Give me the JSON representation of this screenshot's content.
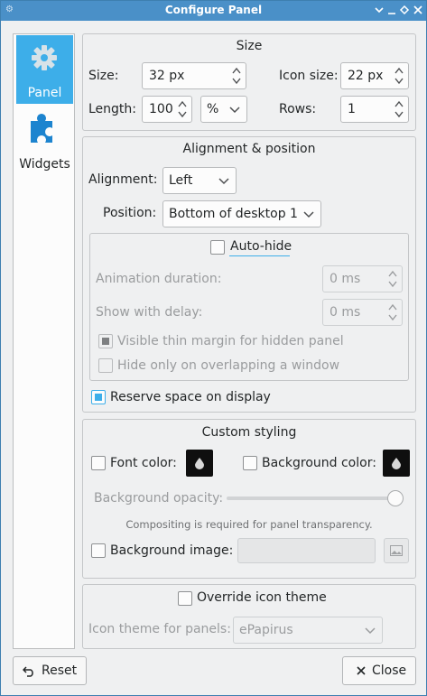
{
  "window": {
    "title": "Configure Panel"
  },
  "sidebar": {
    "items": [
      {
        "label": "Panel",
        "icon": "gear-icon",
        "active": true
      },
      {
        "label": "Widgets",
        "icon": "puzzle-icon",
        "active": false
      }
    ]
  },
  "size_group": {
    "title": "Size",
    "size_label": "Size:",
    "size_value": "32 px",
    "icon_size_label": "Icon size:",
    "icon_size_value": "22 px",
    "length_label": "Length:",
    "length_value": "100",
    "length_unit": "%",
    "rows_label": "Rows:",
    "rows_value": "1"
  },
  "alignment_group": {
    "title": "Alignment & position",
    "alignment_label": "Alignment:",
    "alignment_value": "Left",
    "position_label": "Position:",
    "position_value": "Bottom of desktop 1",
    "autohide_label": "Auto-hide",
    "animation_label": "Animation duration:",
    "animation_value": "0 ms",
    "delay_label": "Show with delay:",
    "delay_value": "0 ms",
    "thin_margin_label": "Visible thin margin for hidden panel",
    "overlap_label": "Hide only on overlapping a window",
    "reserve_label": "Reserve space on display"
  },
  "styling_group": {
    "title": "Custom styling",
    "font_color_label": "Font color:",
    "bg_color_label": "Background color:",
    "opacity_label": "Background opacity:",
    "opacity_value_percent": 100,
    "compositing_note": "Compositing is required for panel transparency.",
    "bg_image_label": "Background image:"
  },
  "icon_theme_group": {
    "override_label": "Override icon theme",
    "theme_label": "Icon theme for panels:",
    "theme_value": "ePapirus"
  },
  "buttons": {
    "reset": "Reset",
    "close": "Close"
  },
  "colors": {
    "accent": "#3daee9",
    "titlebar": "#4a90c8"
  }
}
